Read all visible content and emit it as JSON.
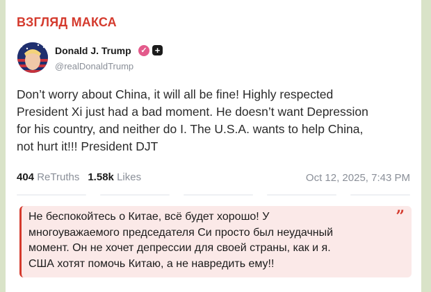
{
  "channel": {
    "title": "ВЗГЛЯД МАКСА",
    "accent": "#d43a2d"
  },
  "post": {
    "author_name": "Donald J. Trump",
    "verified_icon": "verified-badge-icon",
    "plus_icon": "plus-badge-icon",
    "handle": "@realDonaldTrump",
    "text": "Don’t worry about China, it will all be fine! Highly respected\nPresident Xi just had a bad moment. He doesn’t want Depression\nfor his country, and neither do I. The U.S.A. wants to help China,\nnot hurt it!!!  President DJT",
    "retruths_count": "404",
    "retruths_label": "ReTruths",
    "likes_count": "1.58k",
    "likes_label": "Likes",
    "timestamp": "Oct 12, 2025, 7:43 PM"
  },
  "quote": {
    "text": "Не беспокойтесь о Китае, всё будет хорошо! У\nмногоуважаемого председателя Си просто был неудачный\nмомент. Он не хочет депрессии для своей страны, как и я.\nСША хотят помочь Китаю, а не навредить ему!!",
    "mark": "”",
    "background": "#fbe9e8"
  }
}
